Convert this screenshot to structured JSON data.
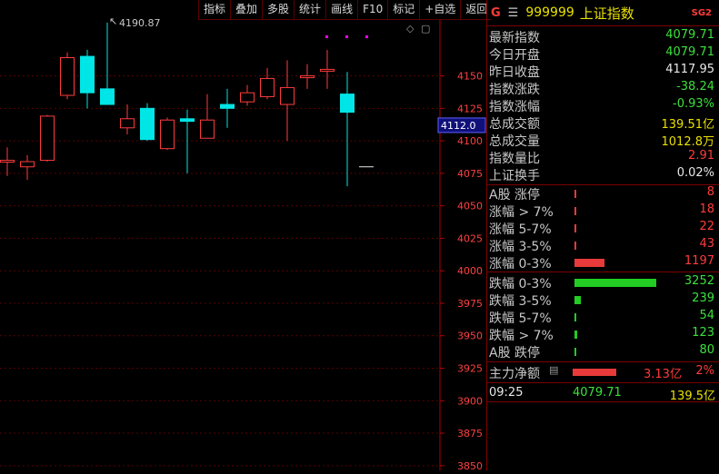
{
  "toolbar": [
    "指标",
    "叠加",
    "多股",
    "统计",
    "画线",
    "F10",
    "标记",
    "+自选",
    "返回"
  ],
  "chart": {
    "high_label": "4190.87",
    "price_tag": "4112.0",
    "y_ticks": [
      4150,
      4125,
      4100,
      4075,
      4050,
      4025,
      4000,
      3975,
      3950,
      3925,
      3900,
      3875,
      3850
    ]
  },
  "chart_data": {
    "type": "candlestick",
    "ylim": [
      3838,
      4200
    ],
    "candles": [
      {
        "o": 4085,
        "c": 4085,
        "h": 4095,
        "l": 4073
      },
      {
        "o": 4080,
        "c": 4084,
        "h": 4089,
        "l": 4070
      },
      {
        "o": 4085,
        "c": 4119,
        "h": 4120,
        "l": 4084
      },
      {
        "o": 4135,
        "c": 4164,
        "h": 4168,
        "l": 4132
      },
      {
        "o": 4165,
        "c": 4137,
        "h": 4170,
        "l": 4125
      },
      {
        "o": 4140,
        "c": 4128,
        "h": 4191,
        "l": 4128
      },
      {
        "o": 4110,
        "c": 4117,
        "h": 4128,
        "l": 4105
      },
      {
        "o": 4125,
        "c": 4101,
        "h": 4129,
        "l": 4100
      },
      {
        "o": 4094,
        "c": 4116,
        "h": 4118,
        "l": 4093
      },
      {
        "o": 4117,
        "c": 4115,
        "h": 4124,
        "l": 4075
      },
      {
        "o": 4102,
        "c": 4116,
        "h": 4136,
        "l": 4102
      },
      {
        "o": 4128,
        "c": 4125,
        "h": 4140,
        "l": 4110
      },
      {
        "o": 4130,
        "c": 4137,
        "h": 4143,
        "l": 4127
      },
      {
        "o": 4134,
        "c": 4148,
        "h": 4156,
        "l": 4132
      },
      {
        "o": 4128,
        "c": 4141,
        "h": 4162,
        "l": 4100
      },
      {
        "o": 4150,
        "c": 4150,
        "h": 4159,
        "l": 4140
      },
      {
        "o": 4155,
        "c": 4155,
        "h": 4170,
        "l": 4140
      },
      {
        "o": 4136,
        "c": 4122,
        "h": 4153,
        "l": 4065
      }
    ],
    "last_tick_price": 4080
  },
  "header": {
    "g": "G",
    "menu": "☰",
    "code": "999999",
    "name": "上证指数",
    "tag": "SG2"
  },
  "quotes": [
    {
      "label": "最新指数",
      "value": "4079.71",
      "color": "#3ce03c"
    },
    {
      "label": "今日开盘",
      "value": "4079.71",
      "color": "#3ce03c"
    },
    {
      "label": "昨日收盘",
      "value": "4117.95",
      "color": "#e8e8e8"
    },
    {
      "label": "指数涨跌",
      "value": "-38.24",
      "color": "#3ce03c"
    },
    {
      "label": "指数涨幅",
      "value": "-0.93%",
      "color": "#3ce03c"
    },
    {
      "label": "总成交额",
      "value": "139.51亿",
      "color": "#e8e000"
    },
    {
      "label": "总成交量",
      "value": "1012.8万",
      "color": "#e8e000"
    },
    {
      "label": "指数量比",
      "value": "2.91",
      "color": "#ff3b3b"
    },
    {
      "label": "上证换手",
      "value": "0.02%",
      "color": "#e8e8e8"
    }
  ],
  "breadth_up": [
    {
      "label": "A股 涨停",
      "value": "8",
      "ratio": 0.003
    },
    {
      "label": "涨幅 > 7%",
      "value": "18",
      "ratio": 0.006
    },
    {
      "label": "涨幅 5-7%",
      "value": "22",
      "ratio": 0.007
    },
    {
      "label": "涨幅 3-5%",
      "value": "43",
      "ratio": 0.013
    },
    {
      "label": "涨幅 0-3%",
      "value": "1197",
      "ratio": 0.368
    }
  ],
  "breadth_down": [
    {
      "label": "跌幅 0-3%",
      "value": "3252",
      "ratio": 1.0
    },
    {
      "label": "跌幅 3-5%",
      "value": "239",
      "ratio": 0.073
    },
    {
      "label": "跌幅 5-7%",
      "value": "54",
      "ratio": 0.017
    },
    {
      "label": "跌幅 > 7%",
      "value": "123",
      "ratio": 0.038
    },
    {
      "label": "A股 跌停",
      "value": "80",
      "ratio": 0.025
    }
  ],
  "net": {
    "label": "主力净额",
    "value": "3.13亿",
    "pct": "2%",
    "ratio": 0.55
  },
  "footer": {
    "time": "09:25",
    "price": "4079.71",
    "amount": "139.5亿"
  },
  "colors": {
    "up": "#ff3b3b",
    "down": "#00e5e5",
    "green": "#22cc22",
    "red": "#e83a3a",
    "grid": "#5a0000"
  }
}
